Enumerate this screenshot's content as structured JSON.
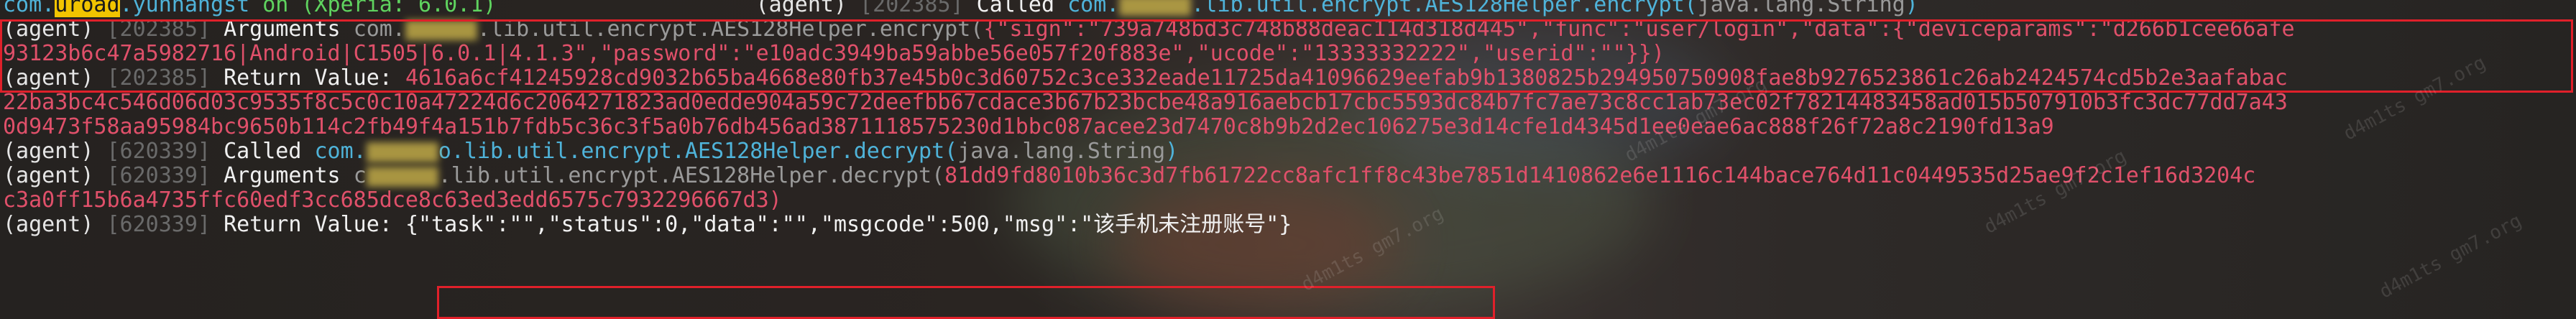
{
  "header": {
    "pkg_prefix": "com.",
    "pkg_highlight": "uroad",
    "pkg_suffix": ".yunnangst",
    "on_text": " on (Xperia: 6.0.1)",
    "agent": "(agent)",
    "pid_partial": "[202385]",
    "called_label": "Called ",
    "method_pkg_prefix": "com.",
    "method_pkg_suffix": ".lib.util.encrypt.AES128Helper.encrypt(",
    "method_arg": "java.lang.String",
    "method_close": ")"
  },
  "log": [
    {
      "agent": "(agent)",
      "pid": "[202385]",
      "label": "Arguments ",
      "method_prefix": "com.",
      "method_suffix": ".lib.util.encrypt.AES128Helper.encrypt(",
      "args": "{\"sign\":\"739a748bd3c748b88deac114d318d445\",\"func\":\"user/login\",\"data\":{\"deviceparams\":\"d266b1cee66afe",
      "args_cont": "93123b6c47a5982716|Android|C1505|6.0.1|4.1.3\",\"password\":\"e10adc3949ba59abbe56e057f20f883e\",\"ucode\":\"13333332222\",\"userid\":\"\"}})"
    },
    {
      "agent": "(agent)",
      "pid": "[202385]",
      "label": "Return Value: ",
      "value": "4616a6cf41245928cd9032b65ba4668e80fb37e45b0c3d60752c3ce332eade11725da41096629eefab9b1380825b294950750908fae8b9276523861c26ab2424574cd5b2e3aafabac",
      "value_cont1": "22ba3bc4c546d06d03c9535f8c5c0c10a47224d6c2064271823ad0edde904a59c72deefbb67cdace3b67b23bcbe48a916aebcb17cbc5593dc84b7fc7ae73c8cc1ab73ec02f78214483458ad015b507910b3fc3dc77dd7a43",
      "value_cont2": "0d9473f58aa95984bc9650b114c2fb49f4a151b7fdb5c36c3f5a0b76db456ad3871118575230d1bbc087acee23d7470c8b9b2d2ec106275e3d14cfe1d4345d1ee0eae6ac888f26f72a8c2190fd13a9"
    },
    {
      "agent": "(agent)",
      "pid": "[620339]",
      "label": "Called ",
      "method_prefix": "com.",
      "method_suffix": "o.lib.util.encrypt.AES128Helper.decrypt(",
      "method_arg": "java.lang.String",
      "method_close": ")"
    },
    {
      "agent": "(agent)",
      "pid": "[620339]",
      "label": "Arguments ",
      "method_prefix": "c",
      "method_suffix": ".lib.util.encrypt.AES128Helper.decrypt(",
      "args": "81dd9fd8010b36c3d7fb61722cc8afc1ff8c43be7851d1410862e6e1116c144bace764d11c0449535d25ae9f2c1ef16d3204c",
      "args_cont": "c3a0ff15b6a4735ffc60edf3cc685dce8c63ed3edd6575c7932296667d3)"
    },
    {
      "agent": "(agent)",
      "pid": "[620339]",
      "label": "Return Value: ",
      "value": "{\"task\":\"\",\"status\":0,\"data\":\"\",\"msgcode\":500,\"msg\":\"该手机未注册账号\"}"
    }
  ],
  "watermark": "d4m1ts gm7.org",
  "colors": {
    "highlight": "#f2c400",
    "package": "#4fb3d9",
    "args": "#e0506a",
    "box": "#e0202a"
  }
}
